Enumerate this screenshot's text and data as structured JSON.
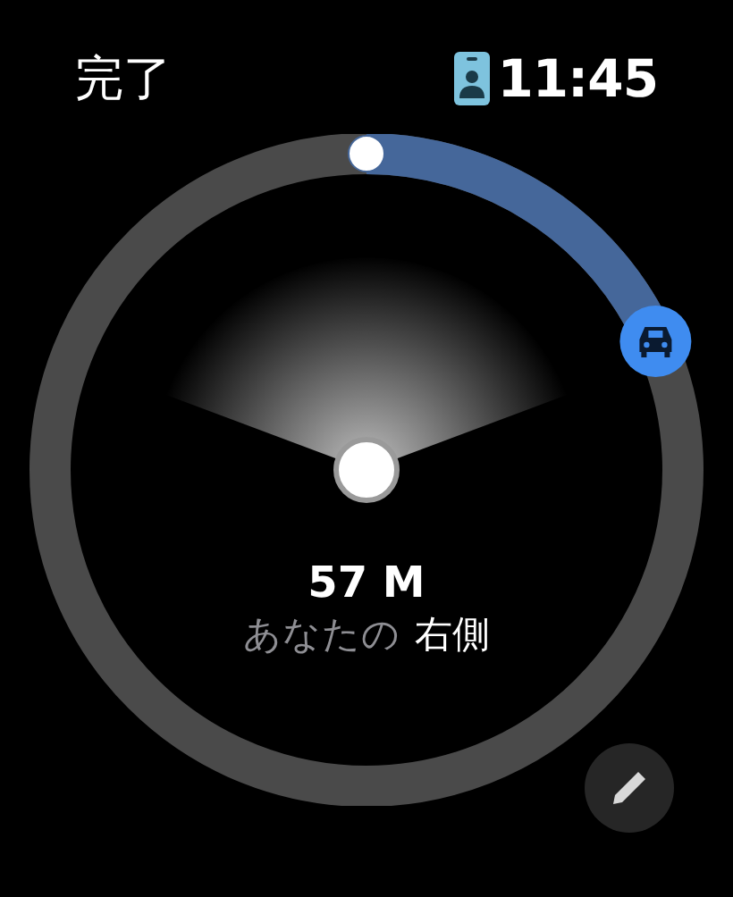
{
  "header": {
    "done_label": "完了",
    "time": "11:45"
  },
  "distance": {
    "value": "57 M",
    "direction_prefix": "あなたの",
    "direction": "右側"
  }
}
